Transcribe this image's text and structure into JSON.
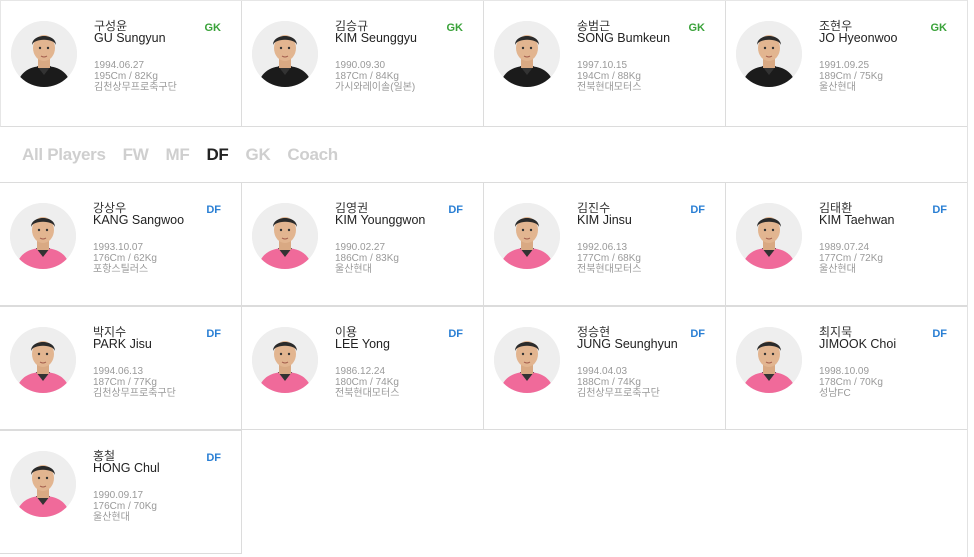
{
  "colors": {
    "gk": "#3aa23a",
    "df": "#2a7fd4",
    "tab_active": "#222222",
    "tab_inactive": "#cfcfcf",
    "kit_gk": "#1b1b1b",
    "kit_df": "#f06a9a"
  },
  "tabs": [
    {
      "label": "All Players",
      "active": false
    },
    {
      "label": "FW",
      "active": false
    },
    {
      "label": "MF",
      "active": false
    },
    {
      "label": "DF",
      "active": true
    },
    {
      "label": "GK",
      "active": false
    },
    {
      "label": "Coach",
      "active": false
    }
  ],
  "goalkeepers": [
    {
      "kor": "구성윤",
      "eng": "GU Sungyun",
      "pos": "GK",
      "birth": "1994.06.27",
      "body": "195Cm / 82Kg",
      "club": "김천상무프로축구단",
      "photo_icon": "player-portrait"
    },
    {
      "kor": "김승규",
      "eng": "KIM Seunggyu",
      "pos": "GK",
      "birth": "1990.09.30",
      "body": "187Cm / 84Kg",
      "club": "가시와레이솔(일본)",
      "photo_icon": "player-portrait"
    },
    {
      "kor": "송범근",
      "eng": "SONG Bumkeun",
      "pos": "GK",
      "birth": "1997.10.15",
      "body": "194Cm / 88Kg",
      "club": "전북현대모터스",
      "photo_icon": "player-portrait"
    },
    {
      "kor": "조현우",
      "eng": "JO Hyeonwoo",
      "pos": "GK",
      "birth": "1991.09.25",
      "body": "189Cm / 75Kg",
      "club": "울산현대",
      "photo_icon": "player-portrait"
    }
  ],
  "defenders": [
    {
      "kor": "강상우",
      "eng": "KANG Sangwoo",
      "pos": "DF",
      "birth": "1993.10.07",
      "body": "176Cm / 62Kg",
      "club": "포항스틸러스"
    },
    {
      "kor": "김영권",
      "eng": "KIM Younggwon",
      "pos": "DF",
      "birth": "1990.02.27",
      "body": "186Cm / 83Kg",
      "club": "울산현대"
    },
    {
      "kor": "김진수",
      "eng": "KIM Jinsu",
      "pos": "DF",
      "birth": "1992.06.13",
      "body": "177Cm / 68Kg",
      "club": "전북현대모터스"
    },
    {
      "kor": "김태환",
      "eng": "KIM Taehwan",
      "pos": "DF",
      "birth": "1989.07.24",
      "body": "177Cm / 72Kg",
      "club": "울산현대"
    },
    {
      "kor": "박지수",
      "eng": "PARK Jisu",
      "pos": "DF",
      "birth": "1994.06.13",
      "body": "187Cm / 77Kg",
      "club": "김천상무프로축구단"
    },
    {
      "kor": "이용",
      "eng": "LEE Yong",
      "pos": "DF",
      "birth": "1986.12.24",
      "body": "180Cm / 74Kg",
      "club": "전북현대모터스"
    },
    {
      "kor": "정승현",
      "eng": "JUNG Seunghyun",
      "pos": "DF",
      "birth": "1994.04.03",
      "body": "188Cm / 74Kg",
      "club": "김천상무프로축구단"
    },
    {
      "kor": "최지묵",
      "eng": "JIMOOK Choi",
      "pos": "DF",
      "birth": "1998.10.09",
      "body": "178Cm / 70Kg",
      "club": "성남FC"
    },
    {
      "kor": "홍철",
      "eng": "HONG Chul",
      "pos": "DF",
      "birth": "1990.09.17",
      "body": "176Cm / 70Kg",
      "club": "울산현대"
    }
  ]
}
